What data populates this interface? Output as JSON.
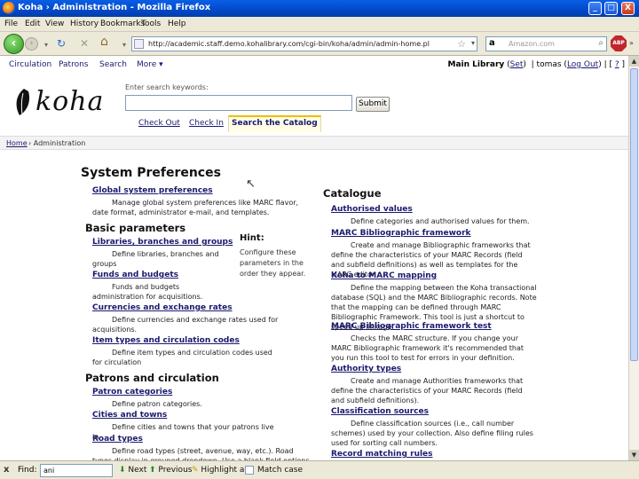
{
  "window": {
    "title": "Koha › Administration - Mozilla Firefox",
    "controls": [
      "_",
      "□",
      "X"
    ]
  },
  "menu": [
    "File",
    "Edit",
    "View",
    "History",
    "Bookmarks",
    "Tools",
    "Help"
  ],
  "toolbar": {
    "url": "http://academic.staff.demo.kohalibrary.com/cgi-bin/koha/admin/admin-home.pl",
    "search_placeholder": "Amazon.com",
    "adblock_label": "ABP"
  },
  "koha_header": {
    "nav": [
      "Circulation",
      "Patrons",
      "Search",
      "More ▾"
    ],
    "library": "Main Library",
    "set_label": "Set",
    "user": "tomas",
    "logout_label": "Log Out",
    "help_label": "?"
  },
  "logo_text": "koha",
  "search": {
    "label": "Enter search keywords:",
    "submit_label": "Submit",
    "tabs": [
      "Check Out",
      "Check In",
      "Search the Catalog"
    ]
  },
  "breadcrumb": {
    "home": "Home",
    "current": "› Administration"
  },
  "page_title": "System Preferences",
  "global": {
    "link": "Global system preferences",
    "desc": "Manage global system preferences like MARC flavor, date format, administrator e-mail, and templates."
  },
  "basic": {
    "heading": "Basic parameters",
    "items": [
      {
        "link": "Libraries, branches and groups",
        "desc": "Define libraries, branches and groups"
      },
      {
        "link": "Funds and budgets",
        "desc": "Funds and budgets administration for acquisitions."
      },
      {
        "link": "Currencies and exchange rates",
        "desc": "Define currencies and exchange rates used for acquisitions."
      },
      {
        "link": "Item types and circulation codes",
        "desc": "Define item types and circulation codes used for circulation"
      }
    ]
  },
  "patrons": {
    "heading": "Patrons and circulation",
    "items": [
      {
        "link": "Patron categories",
        "desc": "Define patron categories."
      },
      {
        "link": "Cities and towns",
        "desc": "Define cities and towns that your patrons live in."
      },
      {
        "link": "Road types",
        "desc": "Define road types (street, avenue, way, etc.). Road types display in grouped dropdown. Use a blank field options and grouped"
      }
    ]
  },
  "hint": {
    "heading": "Hint:",
    "text": "Configure these parameters in the order they appear."
  },
  "catalogue": {
    "heading": "Catalogue",
    "items": [
      {
        "link": "Authorised values",
        "desc": "Define categories and authorised values for them."
      },
      {
        "link": "MARC Bibliographic framework",
        "desc": "Create and manage Bibliographic frameworks that define the characteristics of your MARC Records (field and subfield definitions) as well as templates for the MARC editor."
      },
      {
        "link": "Koha to MARC mapping",
        "desc": "Define the mapping between the Koha transactional database (SQL) and the MARC Bibliographic records. Note that the mapping can be defined through MARC Bibliographic Framework. This tool is just a shortcut to speed up linkage."
      },
      {
        "link": "MARC Bibliographic framework test",
        "desc": "Checks the MARC structure. If you change your MARC Bibliographic framework it's recommended that you run this tool to test for errors in your definition."
      },
      {
        "link": "Authority types",
        "desc": "Create and manage Authorities frameworks that define the characteristics of your MARC Records (field and subfield definitions)."
      },
      {
        "link": "Classification sources",
        "desc": "Define classification sources (i.e., call number schemes) used by your collection. Also define filing rules used for sorting call numbers."
      },
      {
        "link": "Record matching rules",
        "desc": ""
      }
    ]
  },
  "findbar": {
    "close": "x",
    "label": "Find:",
    "value": "ani",
    "next": "Next",
    "previous": "Previous",
    "highlight": "Highlight all",
    "match_case": "Match case"
  }
}
